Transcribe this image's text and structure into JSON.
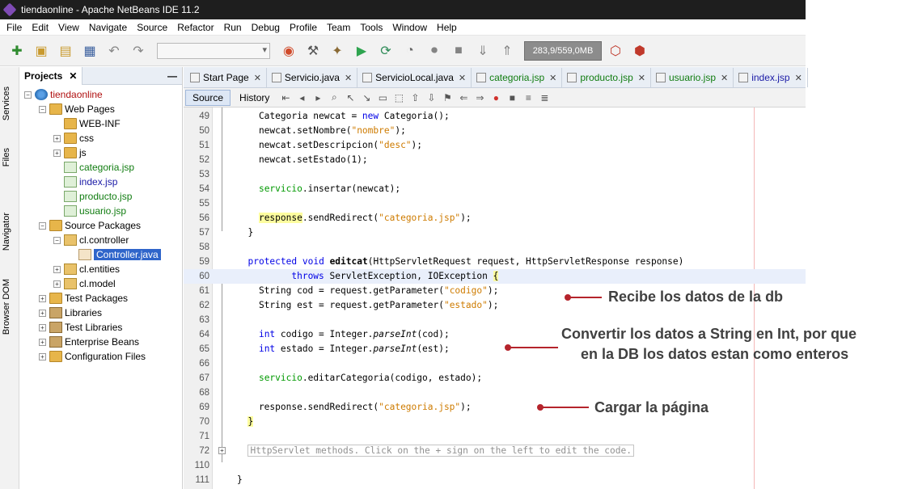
{
  "window": {
    "title": "tiendaonline - Apache NetBeans IDE 11.2"
  },
  "menu": [
    "File",
    "Edit",
    "View",
    "Navigate",
    "Source",
    "Refactor",
    "Run",
    "Debug",
    "Profile",
    "Team",
    "Tools",
    "Window",
    "Help"
  ],
  "toolbar": {
    "memory": "283,9/559,0MB",
    "config_select": ""
  },
  "left_strip": [
    "Services",
    "Files",
    "Navigator",
    "Browser DOM"
  ],
  "projects": {
    "tab_label": "Projects",
    "tree": [
      {
        "label": "tiendaonline",
        "level": 0,
        "icon": "globe-icon",
        "color": "red"
      },
      {
        "label": "Web Pages",
        "level": 1,
        "icon": "folder-icon"
      },
      {
        "label": "WEB-INF",
        "level": 2,
        "icon": "folder-icon"
      },
      {
        "label": "css",
        "level": 2,
        "icon": "folder-icon"
      },
      {
        "label": "js",
        "level": 2,
        "icon": "folder-icon"
      },
      {
        "label": "categoria.jsp",
        "level": 2,
        "icon": "jsp-icon",
        "color": "green"
      },
      {
        "label": "index.jsp",
        "level": 2,
        "icon": "jsp-icon",
        "color": "blue"
      },
      {
        "label": "producto.jsp",
        "level": 2,
        "icon": "jsp-icon",
        "color": "green"
      },
      {
        "label": "usuario.jsp",
        "level": 2,
        "icon": "jsp-icon",
        "color": "green"
      },
      {
        "label": "Source Packages",
        "level": 1,
        "icon": "folder-icon"
      },
      {
        "label": "cl.controller",
        "level": 2,
        "icon": "package-icon"
      },
      {
        "label": "Controller.java",
        "level": 3,
        "icon": "java-file-icon",
        "selected": true
      },
      {
        "label": "cl.entities",
        "level": 2,
        "icon": "package-icon"
      },
      {
        "label": "cl.model",
        "level": 2,
        "icon": "package-icon"
      },
      {
        "label": "Test Packages",
        "level": 1,
        "icon": "folder-icon"
      },
      {
        "label": "Libraries",
        "level": 1,
        "icon": "library-icon"
      },
      {
        "label": "Test Libraries",
        "level": 1,
        "icon": "library-icon"
      },
      {
        "label": "Enterprise Beans",
        "level": 1,
        "icon": "beans-icon"
      },
      {
        "label": "Configuration Files",
        "level": 1,
        "icon": "config-icon"
      }
    ]
  },
  "editor": {
    "tabs": [
      {
        "label": "Start Page",
        "color": "black"
      },
      {
        "label": "Servicio.java",
        "color": "black"
      },
      {
        "label": "ServicioLocal.java",
        "color": "black"
      },
      {
        "label": "categoria.jsp",
        "color": "green"
      },
      {
        "label": "producto.jsp",
        "color": "green"
      },
      {
        "label": "usuario.jsp",
        "color": "green"
      },
      {
        "label": "index.jsp",
        "color": "blue"
      }
    ],
    "source_tab": "Source",
    "history_tab": "History",
    "line_numbers": [
      "49",
      "50",
      "51",
      "52",
      "53",
      "54",
      "55",
      "56",
      "57",
      "58",
      "59",
      "60",
      "61",
      "62",
      "63",
      "64",
      "65",
      "66",
      "67",
      "68",
      "69",
      "70",
      "71",
      "72",
      "110",
      "111"
    ]
  },
  "annotations": {
    "a1": "Recibe los  datos de la db",
    "a2_line1": "Convertir los datos  a String en Int, por que",
    "a2_line2": "en la DB los datos estan como enteros",
    "a3": "Cargar la página"
  }
}
